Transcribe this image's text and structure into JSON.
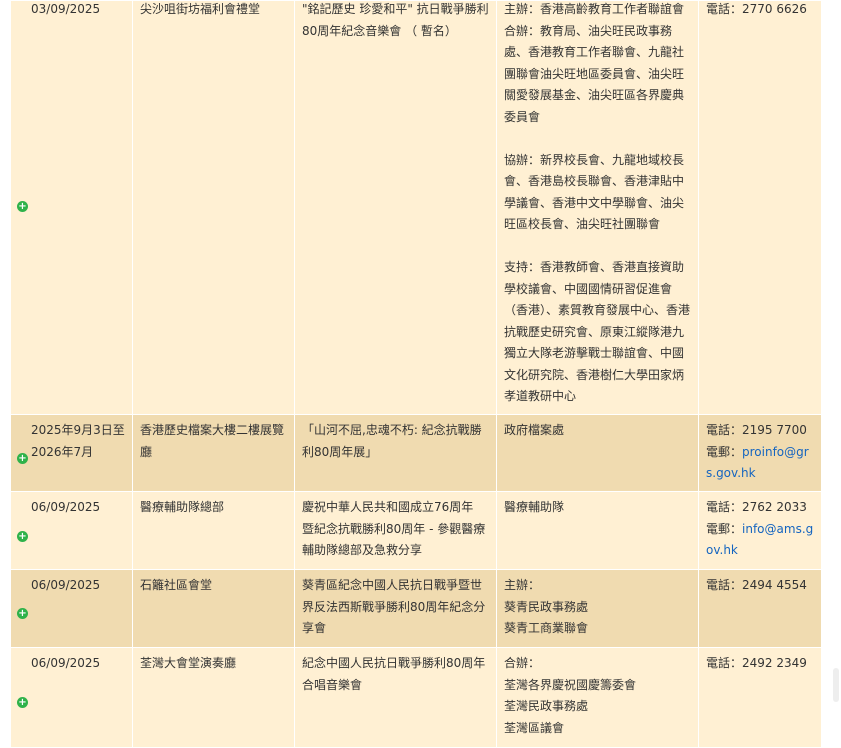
{
  "rows": [
    {
      "date": "03/09/2025",
      "venue": "尖沙咀街坊福利會禮堂",
      "event": "\"銘記歷史 珍愛和平\" 抗日戰爭勝利80周年紀念音樂會 （ 暫名）",
      "organiser_paragraphs": [
        "主辦：香港高齡教育工作者聯誼會 合辦：教育局、油尖旺民政事務處、香港教育工作者聯會、九龍社團聯會油尖旺地區委員會、油尖旺關愛發展基金、油尖旺區各界慶典委員會",
        "協辦：新界校長會、九龍地域校長會、香港島校長聯會、香港津貼中學議會、香港中文中學聯會、油尖旺區校長會、油尖旺社團聯會",
        "支持：香港教師會、香港直接資助學校議會、中國國情研習促進會（香港）、素質教育發展中心、香港抗戰歷史研究會、原東江縱隊港九獨立大隊老游擊戰士聯誼會、中國文化研究院、香港樹仁大學田家炳孝道教研中心"
      ],
      "contact": {
        "phone_label": "電話：",
        "phone": "2770 6626"
      }
    },
    {
      "date": "2025年9月3日至2026年7月",
      "venue": "香港歷史檔案大樓二樓展覽廳",
      "event": "「山河不屈,忠魂不朽: 紀念抗戰勝利80周年展」",
      "organiser_lines": [
        "政府檔案處"
      ],
      "contact": {
        "phone_label": "電話：",
        "phone": "2195 7700",
        "email_label": "電郵：",
        "email": "proinfo@grs.gov.hk"
      }
    },
    {
      "date": "06/09/2025",
      "venue": "醫療輔助隊總部",
      "event": "慶祝中華人民共和國成立76周年 暨紀念抗戰勝利80周年 - 參觀醫療輔助隊總部及急救分享",
      "organiser_lines": [
        "醫療輔助隊"
      ],
      "contact": {
        "phone_label": "電話：",
        "phone": "2762 2033",
        "email_label": "電郵：",
        "email": "info@ams.gov.hk"
      }
    },
    {
      "date": "06/09/2025",
      "venue": "石籬社區會堂",
      "event": "葵青區紀念中國人民抗日戰爭暨世界反法西斯戰爭勝利80周年紀念分享會",
      "organiser_lines": [
        "主辦：",
        "葵青民政事務處",
        "葵青工商業聯會"
      ],
      "contact": {
        "phone_label": "電話：",
        "phone": "2494 4554"
      }
    },
    {
      "date": "06/09/2025",
      "venue": "荃灣大會堂演奏廳",
      "event": "紀念中國人民抗日戰爭勝利80周年合唱音樂會",
      "organiser_lines": [
        "合辦：",
        "荃灣各界慶祝國慶籌委會",
        "荃灣民政事務處",
        "荃灣區議會"
      ],
      "contact": {
        "phone_label": "電話：",
        "phone": "2492 2349"
      }
    }
  ],
  "expand_icon": "plus-circle-icon",
  "colors": {
    "row_light": "#fff0d3",
    "row_dark": "#f0dbb0",
    "expand_icon": "#2fb24a",
    "link": "#1565c0"
  }
}
